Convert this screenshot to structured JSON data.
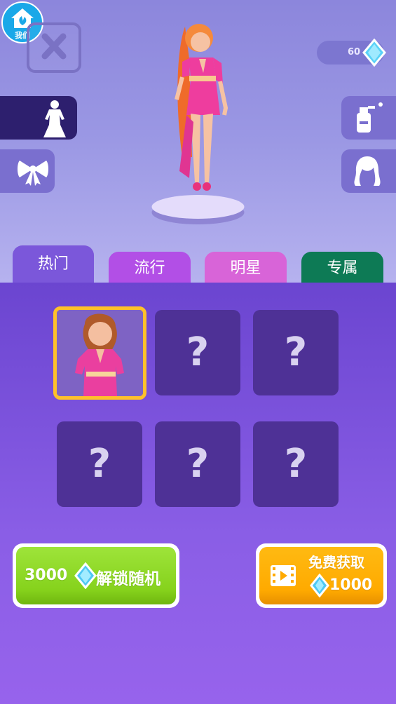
{
  "logo": {
    "label": "我们",
    "icon": "house-leaf-icon"
  },
  "currency": {
    "gems": "60",
    "icon": "diamond-icon"
  },
  "side_menu": {
    "left": [
      {
        "name": "outfit",
        "icon": "dress-silhouette-icon",
        "active": true
      },
      {
        "name": "accessory",
        "icon": "bow-icon",
        "active": false
      }
    ],
    "right": [
      {
        "name": "makeup",
        "icon": "spray-bottle-icon"
      },
      {
        "name": "hair",
        "icon": "hair-icon"
      }
    ]
  },
  "tabs": [
    {
      "label": "热门",
      "color": "#7b57da",
      "active": true
    },
    {
      "label": "流行",
      "color": "#b24fe6",
      "active": false
    },
    {
      "label": "明星",
      "color": "#d864d8",
      "active": false
    },
    {
      "label": "专属",
      "color": "#0d7a55",
      "active": false
    }
  ],
  "grid": {
    "items": [
      {
        "state": "owned",
        "selected": true,
        "label": ""
      },
      {
        "state": "locked",
        "selected": false,
        "label": "?"
      },
      {
        "state": "locked",
        "selected": false,
        "label": "?"
      },
      {
        "state": "locked",
        "selected": false,
        "label": "?"
      },
      {
        "state": "locked",
        "selected": false,
        "label": "?"
      },
      {
        "state": "locked",
        "selected": false,
        "label": "?"
      }
    ]
  },
  "actions": {
    "unlock": {
      "cost": "3000",
      "label": "解锁随机",
      "icon": "diamond-icon",
      "color": "#8fd823"
    },
    "free": {
      "title": "免费获取",
      "amount": "1000",
      "icon": "video-icon",
      "color": "#ffac00"
    }
  }
}
